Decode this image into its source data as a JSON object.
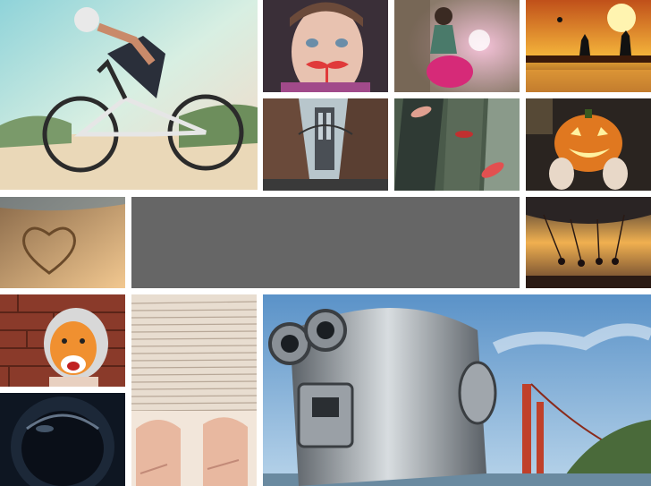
{
  "gallery": {
    "background": "#ffffff",
    "panel_color": "#666666",
    "tiles": [
      {
        "name": "cyclist",
        "icon": "bike-rider-photo"
      },
      {
        "name": "girl-mustache",
        "icon": "girl-with-mustache-prop-photo"
      },
      {
        "name": "scooter-girl",
        "icon": "woman-on-scooter-photo"
      },
      {
        "name": "sunset-soccer",
        "icon": "beach-sunset-soccer-photo"
      },
      {
        "name": "bridge-street",
        "icon": "manhattan-bridge-street-photo"
      },
      {
        "name": "skateboards",
        "icon": "skateboard-decks-photo"
      },
      {
        "name": "pumpkin",
        "icon": "jack-o-lantern-photo"
      },
      {
        "name": "heart-sand",
        "icon": "heart-in-sand-photo"
      },
      {
        "name": "swing-ride",
        "icon": "carnival-swing-ride-photo"
      },
      {
        "name": "tiger-face",
        "icon": "tiger-face-paint-photo"
      },
      {
        "name": "paper-stack",
        "icon": "stack-of-papers-photo"
      },
      {
        "name": "binoculars",
        "icon": "coin-binoculars-golden-gate-photo"
      },
      {
        "name": "astronaut",
        "icon": "astronaut-helmet-photo"
      }
    ]
  }
}
